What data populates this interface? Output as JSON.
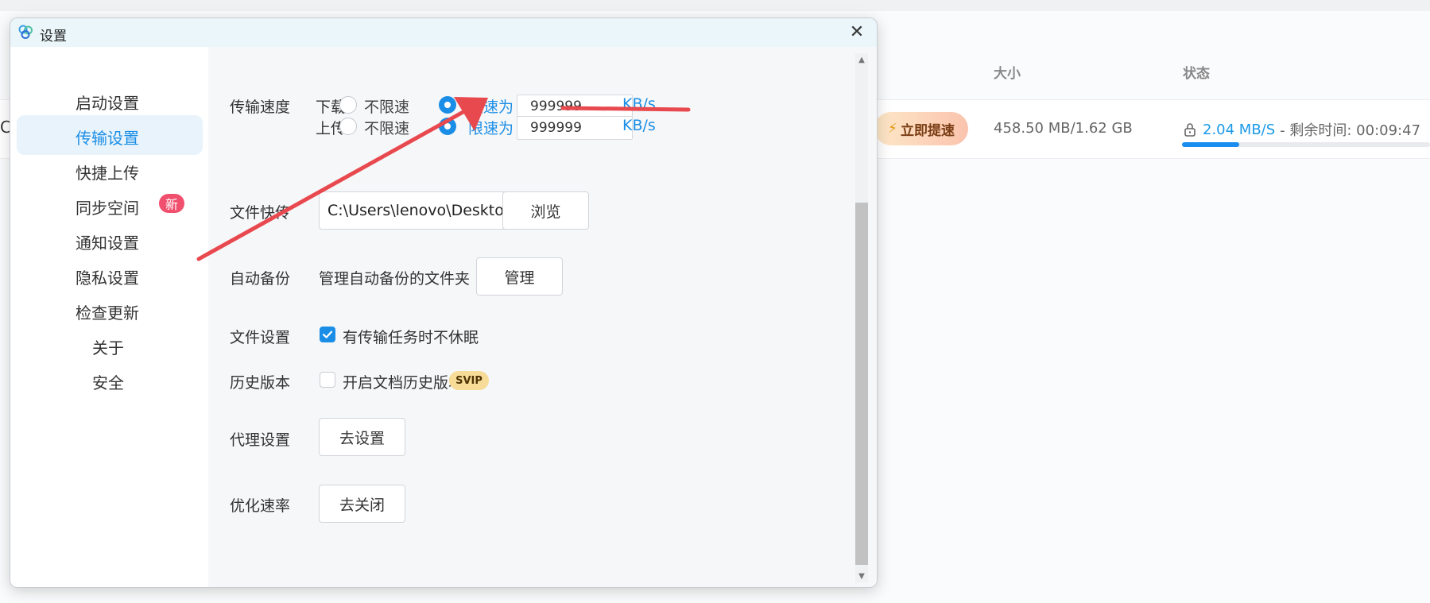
{
  "background_app": {
    "left_fragment": "C",
    "columns": {
      "size": "大小",
      "status": "状态"
    },
    "row": {
      "boost_label": "立即提速",
      "size": "458.50 MB/1.62 GB",
      "speed": "2.04 MB/S",
      "remaining": "- 剩余时间: 00:09:47",
      "progress_fraction": 0.23
    }
  },
  "dialog": {
    "title": "设置",
    "close_glyph": "✕",
    "nav": {
      "startup": "启动设置",
      "transfer": "传输设置",
      "quick_upload": "快捷上传",
      "sync_space": "同步空间",
      "sync_badge": "新",
      "notification": "通知设置",
      "privacy": "隐私设置",
      "check_update": "检查更新",
      "about": "关于",
      "security": "安全"
    },
    "transfer_speed": {
      "label": "传输速度",
      "download_label": "下载",
      "upload_label": "上传",
      "unlimited": "不限速",
      "limit_to": "限速为",
      "download_value": "999999",
      "upload_value": "999999",
      "unit": "KB/s"
    },
    "file_quick": {
      "label": "文件快传",
      "path": "C:\\Users\\lenovo\\Desktop\\...",
      "browse": "浏览"
    },
    "auto_backup": {
      "label": "自动备份",
      "desc": "管理自动备份的文件夹",
      "manage": "管理"
    },
    "file_settings": {
      "label": "文件设置",
      "no_sleep": "有传输任务时不休眠"
    },
    "history": {
      "label": "历史版本",
      "enable": "开启文档历史版本",
      "badge": "SVIP"
    },
    "proxy": {
      "label": "代理设置",
      "button": "去设置"
    },
    "optimize": {
      "label": "优化速率",
      "button": "去关闭"
    }
  },
  "colors": {
    "accent": "#1a8ee6",
    "badge_new": "#f0506e",
    "svip": "#f6dc97",
    "annotation_red": "#e8494f"
  }
}
